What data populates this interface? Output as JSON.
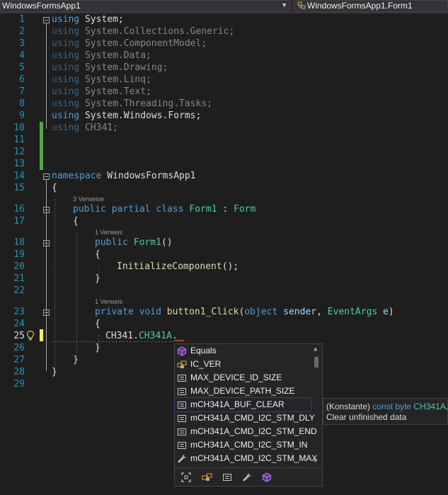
{
  "nav": {
    "project": "WindowsFormsApp1",
    "member": "WindowsFormsApp1.Form1"
  },
  "lines": {
    "l1": {
      "num": "1",
      "kw": "using",
      "ns": "System;"
    },
    "l2": {
      "num": "2",
      "kw": "using",
      "ns": "System.Collections.Generic;"
    },
    "l3": {
      "num": "3",
      "kw": "using",
      "ns": "System.ComponentModel;"
    },
    "l4": {
      "num": "4",
      "kw": "using",
      "ns": "System.Data;"
    },
    "l5": {
      "num": "5",
      "kw": "using",
      "ns": "System.Drawing;"
    },
    "l6": {
      "num": "6",
      "kw": "using",
      "ns": "System.Linq;"
    },
    "l7": {
      "num": "7",
      "kw": "using",
      "ns": "System.Text;"
    },
    "l8": {
      "num": "8",
      "kw": "using",
      "ns": "System.Threading.Tasks;"
    },
    "l9": {
      "num": "9",
      "kw": "using",
      "ns": "System.Windows.Forms;"
    },
    "l10": {
      "num": "10",
      "kw": "using",
      "ns": "CH341;"
    },
    "l11": {
      "num": "11"
    },
    "l12": {
      "num": "12"
    },
    "l13": {
      "num": "13"
    },
    "l14": {
      "num": "14",
      "kw": "namespace",
      "name": "WindowsFormsApp1"
    },
    "l15": {
      "num": "15",
      "text": "{"
    },
    "l16": {
      "num": "16",
      "lens": "3 Verweise",
      "kw1": "public",
      "kw2": "partial",
      "kw3": "class",
      "name": "Form1",
      "sep": ":",
      "base": "Form"
    },
    "l17": {
      "num": "17",
      "text": "{"
    },
    "l18": {
      "num": "18",
      "lens": "1 Verweis",
      "kw": "public",
      "name": "Form1",
      "paren": "()"
    },
    "l19": {
      "num": "19",
      "text": "{"
    },
    "l20": {
      "num": "20",
      "call": "InitializeComponent",
      "rest": "();"
    },
    "l21": {
      "num": "21",
      "text": "}"
    },
    "l22": {
      "num": "22"
    },
    "l23": {
      "num": "23",
      "lens": "1 Verweis",
      "kw1": "private",
      "kw2": "void",
      "name": "button1_Click",
      "open": "(",
      "kw3": "object",
      "p1": "sender",
      "comma": ",",
      "type": "EventArgs",
      "p2": "e",
      "close": ")"
    },
    "l24": {
      "num": "24",
      "text": "{"
    },
    "l25": {
      "num": "25",
      "ns": "CH341",
      "dot1": ".",
      "cls": "CH341A",
      "dot2": "."
    },
    "l26": {
      "num": "26",
      "text": "}"
    },
    "l27": {
      "num": "27",
      "text": "}"
    },
    "l28": {
      "num": "28",
      "text": "}"
    },
    "l29": {
      "num": "29"
    }
  },
  "completion": {
    "items": [
      {
        "label": "Equals",
        "icon": "method-icon"
      },
      {
        "label": "IC_VER",
        "icon": "field-icon"
      },
      {
        "label": "MAX_DEVICE_ID_SIZE",
        "icon": "constant-icon"
      },
      {
        "label": "MAX_DEVICE_PATH_SIZE",
        "icon": "constant-icon"
      },
      {
        "label": "mCH341A_BUF_CLEAR",
        "icon": "constant-icon"
      },
      {
        "label": "mCH341A_CMD_I2C_STM_DLY",
        "icon": "constant-icon"
      },
      {
        "label": "mCH341A_CMD_I2C_STM_END",
        "icon": "constant-icon"
      },
      {
        "label": "mCH341A_CMD_I2C_STM_IN",
        "icon": "constant-icon"
      },
      {
        "label": "mCH341A_CMD_I2C_STM_MAX",
        "icon": "wrench-icon"
      }
    ],
    "filters": [
      "show-all-filter-icon",
      "field-filter-icon",
      "constant-filter-icon",
      "property-filter-icon",
      "method-filter-icon"
    ]
  },
  "quickinfo": {
    "prefix": "(Konstante) ",
    "kw": "const byte ",
    "cls": "CH341A",
    "tail": ".m",
    "desc": "Clear unfinished data"
  },
  "colors": {
    "background": "#1e1e1e",
    "keyword": "#569cd6",
    "type": "#4ec9b0",
    "method": "#dcdcaa",
    "parameter": "#9cdcfe",
    "line_number": "#2b91af",
    "change_saved": "#57a64a",
    "change_unsaved": "#eff556"
  }
}
